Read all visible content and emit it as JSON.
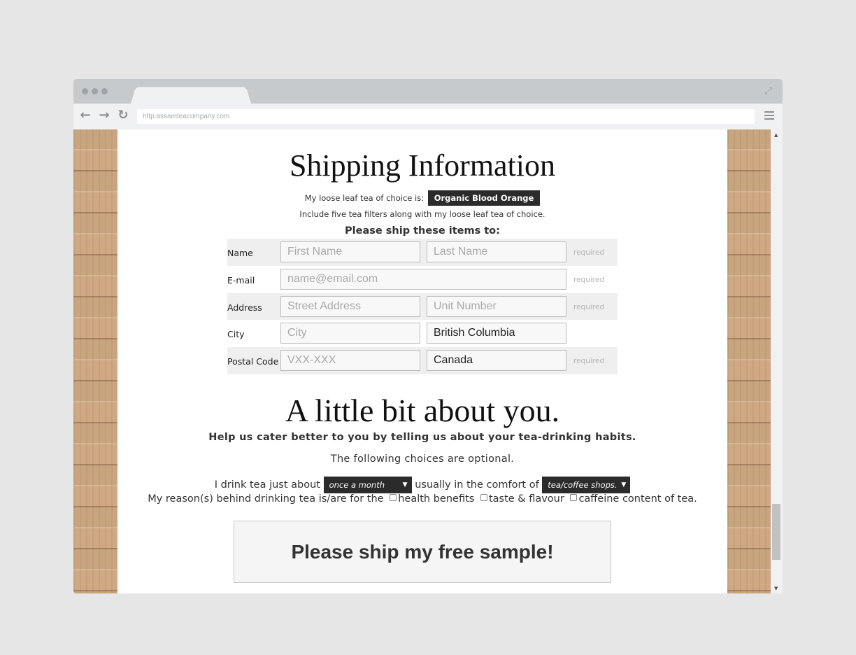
{
  "browser": {
    "url": "http:assamteacompany.com"
  },
  "shipping": {
    "title": "Shipping Information",
    "choice_label": "My loose leaf tea of choice is:",
    "tea_choice": "Organic Blood Orange",
    "filters_note": "Include five tea filters along with my loose leaf tea of choice.",
    "ship_to": "Please ship these items to:",
    "rows": {
      "name": {
        "label": "Name",
        "first_placeholder": "First Name",
        "last_placeholder": "Last Name",
        "required": "required"
      },
      "email": {
        "label": "E-mail",
        "placeholder": "name@email.com",
        "required": "required"
      },
      "address": {
        "label": "Address",
        "street_placeholder": "Street Address",
        "unit_placeholder": "Unit Number",
        "required": "required"
      },
      "city": {
        "label": "City",
        "city_placeholder": "City",
        "province_value": "British Columbia"
      },
      "postal": {
        "label": "Postal Code",
        "postal_placeholder": "VXX-XXX",
        "country_value": "Canada",
        "required": "required"
      }
    }
  },
  "about": {
    "title": "A little bit about you.",
    "help": "Help us cater better to you by telling us about your tea-drinking habits.",
    "optional": "The following choices are optional.",
    "drink_prefix": "I drink tea just about",
    "frequency": "once a month",
    "drink_middle": "usually in the comfort of",
    "location": "tea/coffee shops.",
    "reason_prefix": "My reason(s) behind drinking tea is/are for the",
    "reason_health": "health benefits",
    "reason_taste": "taste & flavour",
    "reason_caffeine": "caffeine content of tea."
  },
  "submit_label": "Please ship my free sample!"
}
